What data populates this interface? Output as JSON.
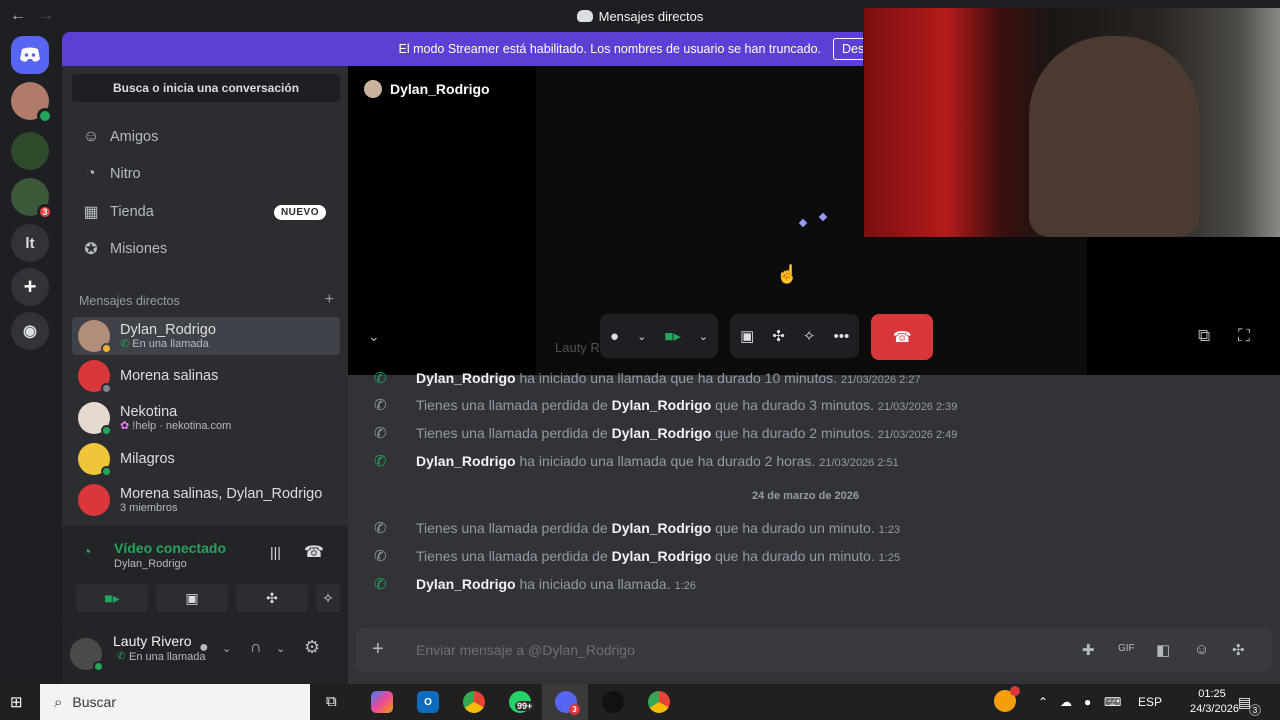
{
  "window": {
    "title": "Mensajes directos",
    "back": "←",
    "forward": "→"
  },
  "banner": {
    "text": "El modo Streamer está habilitado. Los nombres de usuario se han truncado.",
    "button": "Desactivar"
  },
  "guilds": {
    "badge": "3",
    "lt_label": "lt"
  },
  "sidebar": {
    "search": "Busca o inicia una conversación",
    "nav": [
      {
        "label": "Amigos",
        "icon": "friends-icon"
      },
      {
        "label": "Nitro",
        "icon": "nitro-icon"
      },
      {
        "label": "Tienda",
        "icon": "shop-icon",
        "badge": "NUEVO"
      },
      {
        "label": "Misiones",
        "icon": "quests-icon"
      }
    ],
    "dm_header": "Mensajes directos",
    "dms": [
      {
        "name": "Dylan_Rodrigo",
        "sub": "En una llamada",
        "active": true
      },
      {
        "name": "Morena salinas",
        "sub": ""
      },
      {
        "name": "Nekotina",
        "sub": "!help · nekotina.com"
      },
      {
        "name": "Milagros",
        "sub": ""
      },
      {
        "name": "Morena salinas, Dylan_Rodrigo",
        "sub": "3 miembros"
      }
    ],
    "voice": {
      "title": "Vídeo conectado",
      "sub": "Dylan_Rodrigo"
    },
    "user": {
      "name": "Lauty Rivero",
      "status": "En una llamada"
    }
  },
  "call": {
    "header": "Dylan_Rodrigo",
    "ghost": "Lauty R"
  },
  "log": {
    "rows": [
      {
        "type": "started",
        "who": "Dylan_Rodrigo",
        "text": "ha iniciado una llamada que ha durado 10 minutos.",
        "ts": "21/03/2026 2:27"
      },
      {
        "type": "missed",
        "pre": "Tienes una llamada perdida de",
        "who": "Dylan_Rodrigo",
        "text": "que ha durado 3 minutos.",
        "ts": "21/03/2026 2:39"
      },
      {
        "type": "missed",
        "pre": "Tienes una llamada perdida de",
        "who": "Dylan_Rodrigo",
        "text": "que ha durado 2 minutos.",
        "ts": "21/03/2026 2:49"
      },
      {
        "type": "started",
        "who": "Dylan_Rodrigo",
        "text": "ha iniciado una llamada que ha durado 2 horas.",
        "ts": "21/03/2026 2:51"
      },
      {
        "type": "missed",
        "pre": "Tienes una llamada perdida de",
        "who": "Dylan_Rodrigo",
        "text": "que ha durado un minuto.",
        "ts": "1:23"
      },
      {
        "type": "missed",
        "pre": "Tienes una llamada perdida de",
        "who": "Dylan_Rodrigo",
        "text": "que ha durado un minuto.",
        "ts": "1:25"
      },
      {
        "type": "started",
        "who": "Dylan_Rodrigo",
        "text": "ha iniciado una llamada.",
        "ts": "1:26"
      }
    ],
    "date_separator": "24 de marzo de 2026"
  },
  "composer": {
    "placeholder": "Enviar mensaje a @Dylan_Rodrigo"
  },
  "taskbar": {
    "search": "Buscar",
    "whatsapp_badge": "99+",
    "discord_badge": "3",
    "lang": "ESP",
    "time": "01:25",
    "date": "24/3/2026",
    "notif_badge": "3"
  },
  "colors": {
    "accent": "#5d3fd3",
    "green": "#23a55a",
    "red": "#da373c"
  }
}
